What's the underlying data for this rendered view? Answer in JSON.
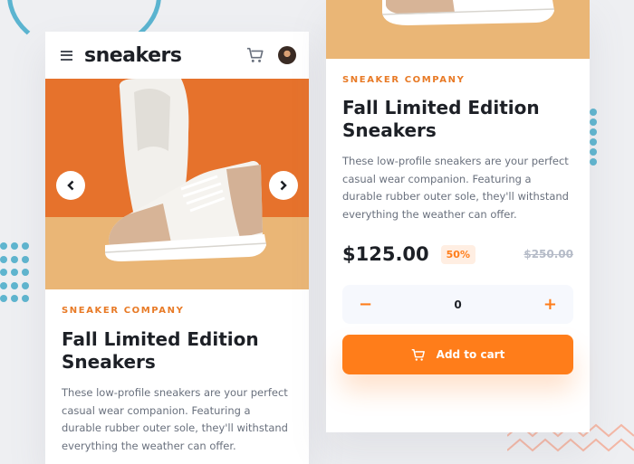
{
  "header": {
    "brand": "sneakers"
  },
  "product": {
    "company": "Sneaker Company",
    "title": "Fall Limited Edition Sneakers",
    "description": "These low-profile sneakers are your perfect casual wear companion. Featuring a durable rubber outer sole, they'll withstand everything the weather can offer.",
    "price": "$125.00",
    "discount": "50%",
    "original_price": "$250.00"
  },
  "cart": {
    "quantity": "0",
    "minus_label": "−",
    "plus_label": "+",
    "add_label": "Add to cart"
  },
  "icons": {
    "menu": "menu-icon",
    "cart": "cart-icon",
    "avatar": "avatar",
    "prev": "chevron-left-icon",
    "next": "chevron-right-icon"
  },
  "colors": {
    "accent": "#ff7d1a",
    "accent_pale": "#ffeee2",
    "dark": "#1d2026",
    "text": "#69707d",
    "deco_blue": "#5fb5cf"
  }
}
